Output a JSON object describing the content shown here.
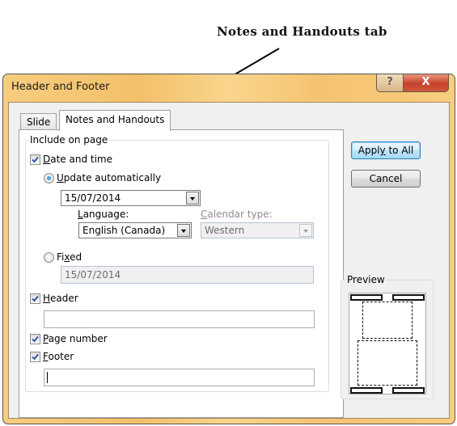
{
  "annotation": {
    "text": "Notes and Handouts tab"
  },
  "window": {
    "title": "Header and Footer",
    "help_label": "?",
    "close_label": "X"
  },
  "tabs": [
    {
      "label": "Slide",
      "active": false
    },
    {
      "label": "Notes and Handouts",
      "active": true
    }
  ],
  "include_group": {
    "label": "Include on page",
    "date_time": {
      "label_mnemonic": "D",
      "label_rest": "ate and time",
      "checked": true,
      "update_auto": {
        "label_mnemonic": "U",
        "label_rest": "pdate automatically",
        "selected": true,
        "date_value": "15/07/2014"
      },
      "language": {
        "label_mnemonic": "L",
        "label_rest": "anguage:",
        "value": "English (Canada)"
      },
      "calendar": {
        "label_mnemonic": "C",
        "label_rest": "alendar type:",
        "value": "Western",
        "disabled": true
      },
      "fixed": {
        "label_pre": "Fi",
        "label_mnemonic": "x",
        "label_post": "ed",
        "selected": false,
        "value": "15/07/2014",
        "disabled": true
      }
    },
    "header": {
      "label_mnemonic": "H",
      "label_rest": "eader",
      "checked": true,
      "value": ""
    },
    "page_number": {
      "label_mnemonic": "P",
      "label_rest": "age number",
      "checked": true
    },
    "footer": {
      "label_mnemonic": "F",
      "label_rest": "ooter",
      "checked": true,
      "value": ""
    }
  },
  "buttons": {
    "apply_all_pre": "Appl",
    "apply_all_mnemonic": "y",
    "apply_all_post": " to All",
    "cancel": "Cancel"
  },
  "preview": {
    "label": "Preview"
  }
}
